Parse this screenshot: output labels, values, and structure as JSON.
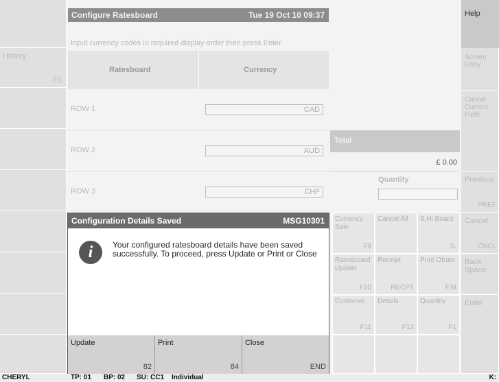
{
  "window": {
    "title": "Configure Ratesboard",
    "datetime": "Tue 19 Oct 10 09:37",
    "instruction": "Input currency codes in required display order then press Enter"
  },
  "left": {
    "history_label": "History",
    "history_key": "F1"
  },
  "table": {
    "headers": [
      "Ratesboard",
      "Currency"
    ],
    "rows": [
      {
        "label": "ROW 1",
        "currency": "CAD"
      },
      {
        "label": "ROW 2",
        "currency": "AUD"
      },
      {
        "label": "ROW 3",
        "currency": "CHF"
      }
    ]
  },
  "total": {
    "label": "Total",
    "amount": "£ 0.00",
    "quantity_label": "Quantity"
  },
  "keys": [
    {
      "label": "Currency Sale",
      "code": "F9"
    },
    {
      "label": "Cancel All",
      "code": ""
    },
    {
      "label": "S.Hi Board",
      "code": "S."
    },
    {
      "label": "Ratesboard Update",
      "code": "F10"
    },
    {
      "label": "Receipt",
      "code": "RECPT"
    },
    {
      "label": "Print Ofrate",
      "code": "F.M"
    },
    {
      "label": "Customer",
      "code": "F11"
    },
    {
      "label": "Details",
      "code": "F12"
    },
    {
      "label": "Quantity",
      "code": "F1"
    },
    {
      "label": "",
      "code": ""
    },
    {
      "label": "",
      "code": ""
    },
    {
      "label": "",
      "code": ""
    }
  ],
  "right": {
    "help": "Help",
    "screen_entry": "Screen Entry",
    "cancel_current": "Cancel Current Field",
    "previous": "Previous",
    "previous_key": "PREF",
    "cancel": "Cancel",
    "cancel_key": "CNCL",
    "back_space": "Back Space",
    "enter": "Enter"
  },
  "dialog": {
    "title": "Configuration Details Saved",
    "code": "MSG10301",
    "message": "Your configured ratesboard details have been saved successfully. To proceed, press Update or Print or Close",
    "buttons": [
      {
        "label": "Update",
        "code": "82"
      },
      {
        "label": "Print",
        "code": "84"
      },
      {
        "label": "Close",
        "code": "END"
      }
    ]
  },
  "status": {
    "user": "CHERYL",
    "tp": "TP: 01",
    "bp": "BP: 02",
    "su": "SU: CC1",
    "mode": "Individual",
    "right": "K:"
  }
}
